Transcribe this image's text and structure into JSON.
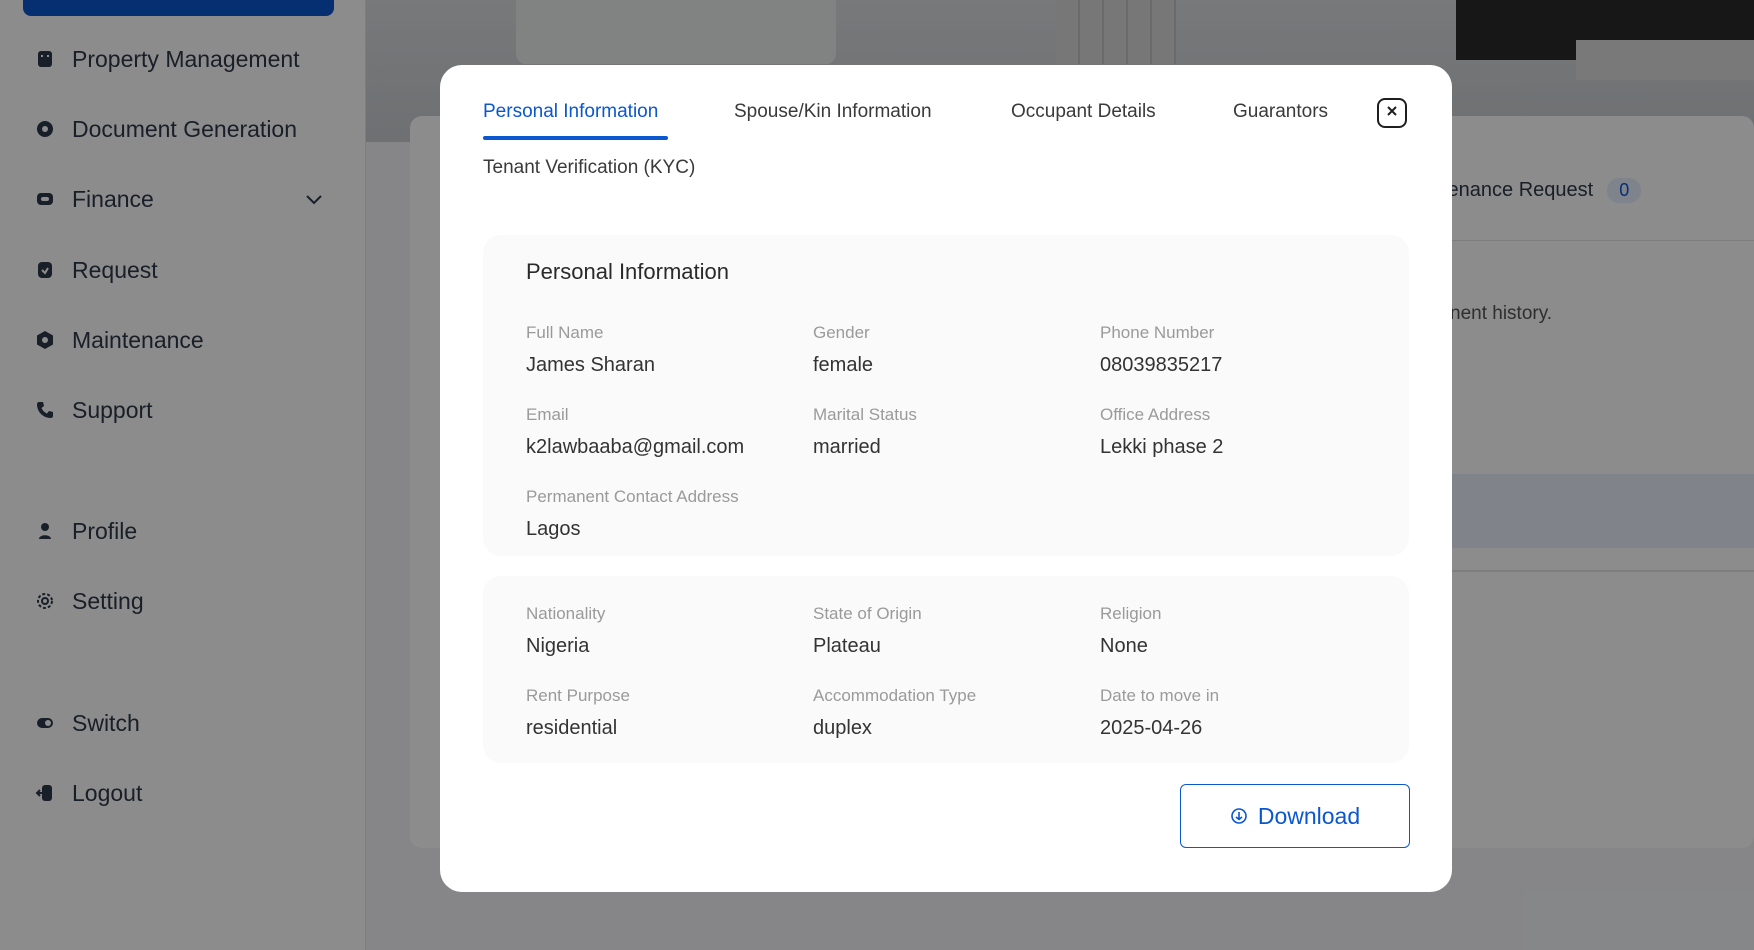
{
  "sidebar": {
    "items": [
      {
        "label": "Property Management",
        "icon": "building-icon"
      },
      {
        "label": "Document Generation",
        "icon": "document-icon"
      },
      {
        "label": "Finance",
        "icon": "wallet-icon"
      },
      {
        "label": "Request",
        "icon": "request-icon"
      },
      {
        "label": "Maintenance",
        "icon": "maintenance-icon"
      },
      {
        "label": "Support",
        "icon": "phone-icon"
      },
      {
        "label": "Profile",
        "icon": "user-icon"
      },
      {
        "label": "Setting",
        "icon": "gear-icon"
      },
      {
        "label": "Switch",
        "icon": "switch-icon"
      },
      {
        "label": "Logout",
        "icon": "logout-icon"
      }
    ]
  },
  "background": {
    "tab_label": "tenance Request",
    "tab_count": "0",
    "history_text": "nent history."
  },
  "modal": {
    "tabs": [
      "Personal Information",
      "Spouse/Kin Information",
      "Occupant Details",
      "Guarantors",
      "Tenant Verification (KYC)"
    ],
    "active_tab": "Personal Information",
    "section_title": "Personal Information",
    "fields_top": [
      {
        "label": "Full Name",
        "value": "James Sharan"
      },
      {
        "label": "Gender",
        "value": "female"
      },
      {
        "label": "Phone Number",
        "value": "08039835217"
      },
      {
        "label": "Email",
        "value": "k2lawbaaba@gmail.com"
      },
      {
        "label": "Marital Status",
        "value": "married"
      },
      {
        "label": "Office Address",
        "value": "Lekki phase 2"
      },
      {
        "label": "Permanent Contact Address",
        "value": "Lagos"
      }
    ],
    "fields_bottom": [
      {
        "label": "Nationality",
        "value": "Nigeria"
      },
      {
        "label": "State of Origin",
        "value": "Plateau"
      },
      {
        "label": "Religion",
        "value": "None"
      },
      {
        "label": "Rent Purpose",
        "value": "residential"
      },
      {
        "label": "Accommodation Type",
        "value": "duplex"
      },
      {
        "label": "Date to move in",
        "value": "2025-04-26"
      }
    ],
    "download_label": "Download"
  },
  "colors": {
    "accent": "#0b57d0",
    "overlay": "rgba(0,0,0,0.45)"
  }
}
